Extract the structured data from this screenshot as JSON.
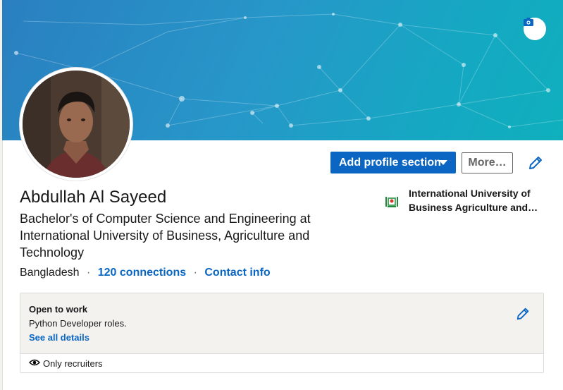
{
  "colors": {
    "primary": "#0a66c2",
    "cover_start": "#2a7fc0",
    "cover_end": "#0fb0bd",
    "panel_bg": "#f3f2ef"
  },
  "cover": {
    "camera_icon": "camera-icon"
  },
  "profile": {
    "name": "Abdullah Al Sayeed",
    "headline": "Bachelor's of Computer Science and Engineering at International University of Business, Agriculture and Technology",
    "location": "Bangladesh",
    "connections": "120 connections",
    "contact_info": "Contact info",
    "separator": "·"
  },
  "actions": {
    "add_section": "Add profile section",
    "more": "More…",
    "edit_icon": "pencil-icon"
  },
  "education": {
    "school": "International University of Business Agriculture and…",
    "logo_icon": "school-logo-icon"
  },
  "open_to_work": {
    "title": "Open to work",
    "roles": "Python Developer roles.",
    "see_details": "See all details",
    "visibility": "Only recruiters",
    "visibility_icon": "eye-icon"
  }
}
